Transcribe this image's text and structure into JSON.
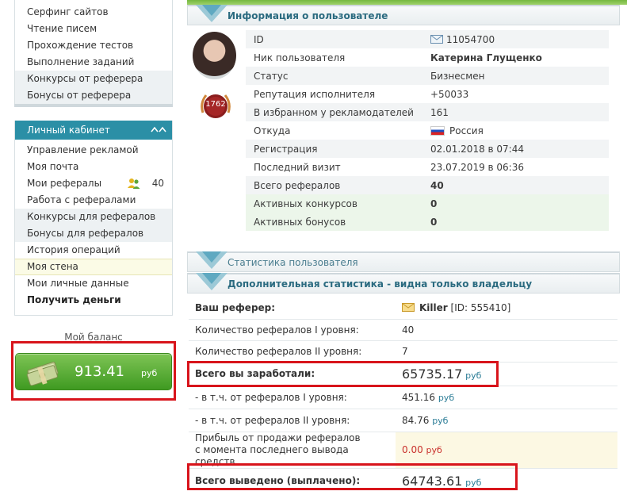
{
  "sidebar_top": {
    "items": [
      {
        "label": "Серфинг сайтов"
      },
      {
        "label": "Чтение писем"
      },
      {
        "label": "Прохождение тестов"
      },
      {
        "label": "Выполнение заданий"
      },
      {
        "label": "Конкурсы от реферера"
      },
      {
        "label": "Бонусы от реферера"
      }
    ]
  },
  "cabinet": {
    "title": "Личный кабинет",
    "items": [
      {
        "label": "Управление рекламой"
      },
      {
        "label": "Моя почта"
      },
      {
        "label": "Мои рефералы",
        "count": "40"
      },
      {
        "label": "Работа с рефералами"
      },
      {
        "label": "Конкурсы для рефералов"
      },
      {
        "label": "Бонусы для рефералов"
      },
      {
        "label": "История операций"
      },
      {
        "label": "Моя стена"
      },
      {
        "label": "Мои личные данные"
      },
      {
        "label": "Получить деньги"
      }
    ]
  },
  "balance": {
    "title": "Мой баланс",
    "amount": "913.41",
    "currency": "руб"
  },
  "user_info": {
    "section_title": "Информация о пользователе",
    "badge_number": "1762",
    "rows": [
      {
        "key": "ID",
        "value": "11054700"
      },
      {
        "key": "Ник пользователя",
        "value": "Катерина Глущенко"
      },
      {
        "key": "Статус",
        "value": "Бизнесмен"
      },
      {
        "key": "Репутация исполнителя",
        "value": "+50033"
      },
      {
        "key": "В избранном у рекламодателей",
        "value": "161"
      },
      {
        "key": "Откуда",
        "value": "Россия"
      },
      {
        "key": "Регистрация",
        "value": "02.01.2018 в 07:44"
      },
      {
        "key": "Последний визит",
        "value": "23.07.2019 в 06:36"
      },
      {
        "key": "Всего рефералов",
        "value": "40"
      },
      {
        "key": "Активных конкурсов",
        "value": "0"
      },
      {
        "key": "Активных бонусов",
        "value": "0"
      }
    ]
  },
  "stats_section": {
    "title": "Статистика пользователя"
  },
  "extra_stats": {
    "title": "Дополнительная статистика - видна только владельцу",
    "referrer_label": "Ваш реферер:",
    "referrer_name": "Killer",
    "referrer_id": "[ID: 555410]",
    "refs_l1_label": "Количество рефералов I уровня:",
    "refs_l1_value": "40",
    "refs_l2_label": "Количество рефералов II уровня:",
    "refs_l2_value": "7",
    "earned_label": "Всего вы заработали:",
    "earned_value": "65735.17",
    "earned_l1_label": "- в т.ч. от рефералов I уровня:",
    "earned_l1_value": "451.16",
    "earned_l2_label": "- в т.ч. от рефералов II уровня:",
    "earned_l2_value": "84.76",
    "sale_profit_label": "Прибыль от продажи рефералов с момента последнего вывода средств",
    "sale_profit_value": "0.00",
    "withdrawn_label": "Всего выведено (выплачено):",
    "withdrawn_value": "64743.61",
    "currency": "руб"
  },
  "colors": {
    "accent": "#2b8fa6",
    "balance_green": "#4fa82b",
    "highlight_red": "#d8141b",
    "nick_red": "#a8132b"
  }
}
